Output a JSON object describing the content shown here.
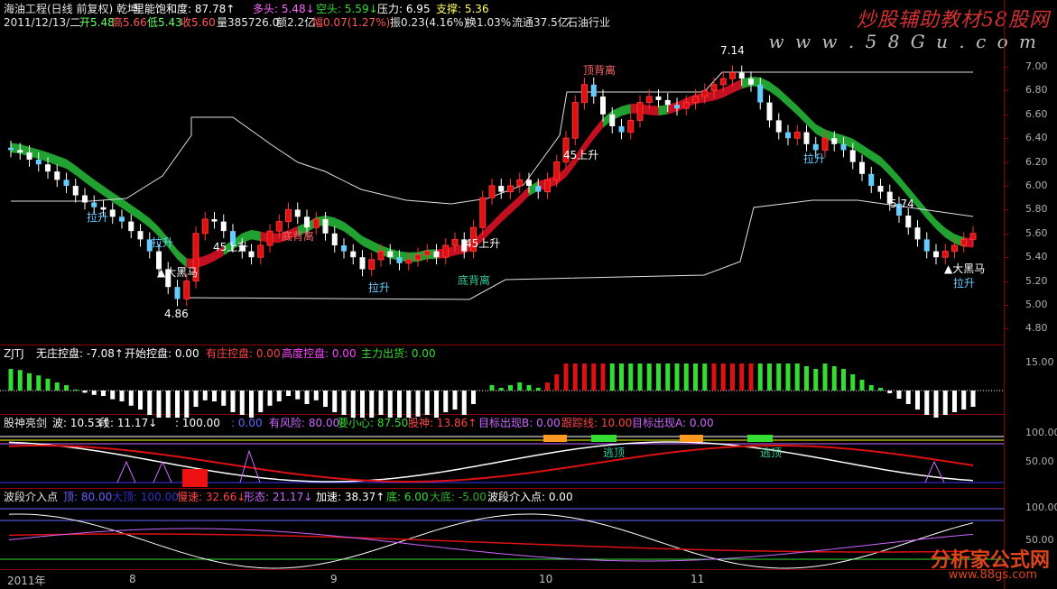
{
  "main_header": {
    "line1": [
      {
        "text": "海油工程(日线 前复权) 乾坤",
        "color": "#e6e6e6"
      },
      {
        "text": "里能饱和度: 87.78↑",
        "color": "#ffffff"
      },
      {
        "text": "多头: 5.48↓",
        "color": "#ff66ff"
      },
      {
        "text": "空头: 5.59↓",
        "color": "#33dd33"
      },
      {
        "text": "压力: 6.95",
        "color": "#ffffff"
      },
      {
        "text": "支撑: 5.36",
        "color": "#ffff66"
      }
    ],
    "line2": [
      {
        "text": "2011/12/13/二",
        "color": "#e6e6e6"
      },
      {
        "text": "开5.48",
        "color": "#66ff66"
      },
      {
        "text": "高5.66",
        "color": "#ff5555"
      },
      {
        "text": "低5.43",
        "color": "#66ff66"
      },
      {
        "text": "收5.60",
        "color": "#ff5555"
      },
      {
        "text": "量385726.0",
        "color": "#e6e6e6"
      },
      {
        "text": "额2.2亿",
        "color": "#e6e6e6"
      },
      {
        "text": "幅0.07(1.27%)",
        "color": "#ff5555"
      },
      {
        "text": "振0.23(4.16%)",
        "color": "#e6e6e6"
      },
      {
        "text": "换1.03%",
        "color": "#e6e6e6"
      },
      {
        "text": "流通37.5亿",
        "color": "#e6e6e6"
      },
      {
        "text": "石油行业",
        "color": "#e6e6e6"
      }
    ]
  },
  "watermark": {
    "top_cn": "炒股辅助教材58股网",
    "top_url": "w w w . 5 8 G u . c o m",
    "bottom_cn": "分析家公式网",
    "bottom_url": "www.88gs.com"
  },
  "price_axis": [
    "7.00",
    "6.80",
    "6.60",
    "6.40",
    "6.20",
    "6.00",
    "5.80",
    "5.60",
    "5.40",
    "5.20",
    "5.00",
    "4.80"
  ],
  "main_annotations": [
    {
      "text": "顶背离",
      "color": "#ff6666"
    },
    {
      "text": "底背离",
      "color": "#ff6666"
    },
    {
      "text": "底背离",
      "color": "#33cc99"
    },
    {
      "text": "45上升",
      "color": "#ffffff"
    },
    {
      "text": "45上升",
      "color": "#ffffff"
    },
    {
      "text": "45上升",
      "color": "#ffffff"
    },
    {
      "text": "拉升",
      "color": "#66ccff"
    },
    {
      "text": "拉升",
      "color": "#66ccff"
    },
    {
      "text": "拉升",
      "color": "#66ccff"
    },
    {
      "text": "拉升",
      "color": "#66ccff"
    },
    {
      "text": "拉升",
      "color": "#66ccff"
    },
    {
      "text": "▲大黑马",
      "color": "#ffffff"
    },
    {
      "text": "▲大黑马",
      "color": "#ffffff"
    },
    {
      "text": "4.86",
      "color": "#ffffff"
    },
    {
      "text": "7.14",
      "color": "#ffffff"
    },
    {
      "text": "5.74",
      "color": "#ffffff"
    }
  ],
  "panel2": {
    "items": [
      {
        "text": "ZJTJ",
        "color": "#e6e6e6"
      },
      {
        "text": "无庄控盘: -7.08↑",
        "color": "#ffffff"
      },
      {
        "text": "开始控盘: 0.00",
        "color": "#ffffff"
      },
      {
        "text": "有庄控盘: 0.00",
        "color": "#ff4444"
      },
      {
        "text": "高度控盘: 0.00",
        "color": "#ff44ff"
      },
      {
        "text": "主力出货: 0.00",
        "color": "#33dd33"
      }
    ],
    "axis": "15.00"
  },
  "panel3": {
    "items": [
      {
        "text": "股神亮剑",
        "color": "#e6e6e6"
      },
      {
        "text": "波: 10.53↑",
        "color": "#ffffff"
      },
      {
        "text": "段: 11.17↓",
        "color": "#ffffff"
      },
      {
        "text": ": 100.00",
        "color": "#ffffff"
      },
      {
        "text": ": 0.00",
        "color": "#6666ff"
      },
      {
        "text": "有风险: 80.00",
        "color": "#cc66ff"
      },
      {
        "text": "要小心: 87.50",
        "color": "#33dd33"
      },
      {
        "text": "股神: 13.86↑",
        "color": "#ff4444"
      },
      {
        "text": "目标出现B: 0.00",
        "color": "#cc66ff"
      },
      {
        "text": "跟踪线: 10.00",
        "color": "#ff4444"
      },
      {
        "text": "目标出现A: 0.00",
        "color": "#cc66ff"
      }
    ],
    "axis": [
      "100.00",
      "50.00"
    ],
    "labels": [
      "逃顶",
      "逃顶"
    ]
  },
  "panel4": {
    "items": [
      {
        "text": "波段介入点",
        "color": "#e6e6e6"
      },
      {
        "text": "顶: 80.00",
        "color": "#6666ff"
      },
      {
        "text": "大顶: 100.00",
        "color": "#3333cc"
      },
      {
        "text": "慢速: 32.66↓",
        "color": "#ff4444"
      },
      {
        "text": "形态: 21.17↓",
        "color": "#cc66ff"
      },
      {
        "text": "加速: 38.37↑",
        "color": "#ffffff"
      },
      {
        "text": "底: 6.00",
        "color": "#33dd33"
      },
      {
        "text": "大底: -5.00",
        "color": "#33aa33"
      },
      {
        "text": "波段介入点: 0.00",
        "color": "#ffffff"
      }
    ],
    "axis": [
      "100.00",
      "50.00"
    ]
  },
  "x_axis": [
    "2011年",
    "8",
    "9",
    "10",
    "11"
  ]
}
